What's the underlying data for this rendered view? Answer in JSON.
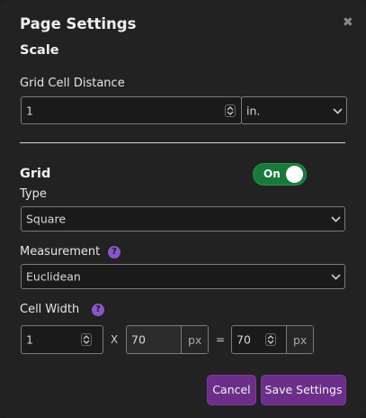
{
  "dialog": {
    "title": "Page Settings",
    "close_icon": "close-icon"
  },
  "scale": {
    "heading": "Scale",
    "grid_cell_distance_label": "Grid Cell Distance",
    "grid_cell_distance_value": "1",
    "unit_selected": "in."
  },
  "grid": {
    "heading": "Grid",
    "toggle_label": "On",
    "toggle_on": true,
    "type_label": "Type",
    "type_selected": "Square",
    "measurement_label": "Measurement",
    "measurement_selected": "Euclidean",
    "cell_width_label": "Cell Width",
    "cell_width_value": "1",
    "multiply_symbol": "X",
    "px_value_1": "70",
    "px_unit_1": "px",
    "equals_symbol": "=",
    "px_value_2": "70",
    "px_unit_2": "px",
    "help_glyph": "?"
  },
  "buttons": {
    "cancel": "Cancel",
    "save": "Save Settings"
  },
  "colors": {
    "toggle_on": "#177a3b",
    "accent_purple": "#6b2f8a",
    "help_purple": "#8a55c9"
  }
}
